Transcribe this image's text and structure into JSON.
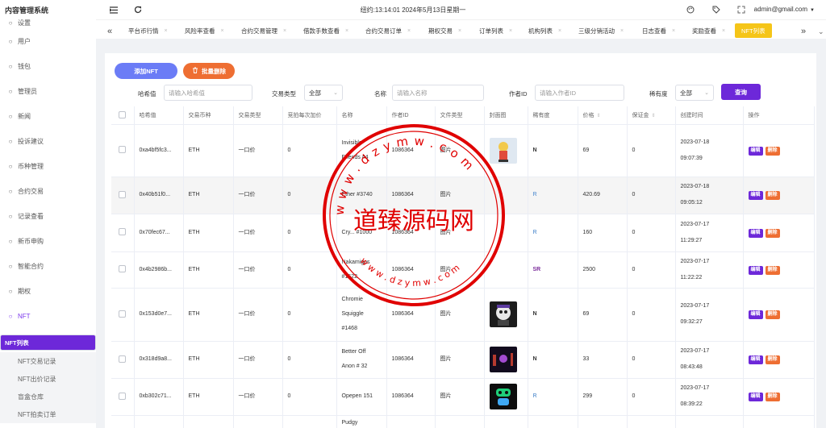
{
  "app": {
    "title": "内容管理系统",
    "datetime": "纽约:13:14:01 2024年5月13日星期一",
    "user": "admin@gmail.com"
  },
  "icons": {
    "menu": "menu-fold-icon",
    "refresh": "refresh-icon",
    "palette": "palette-icon",
    "tag": "tag-icon",
    "fullscreen": "fullscreen-icon"
  },
  "sidebar": {
    "items": [
      {
        "label": "设置",
        "icon": "gear-icon"
      },
      {
        "label": "用户",
        "icon": "user-icon"
      },
      {
        "label": "钱包",
        "icon": "wallet-icon"
      },
      {
        "label": "管理员",
        "icon": "admin-icon"
      },
      {
        "label": "新闻",
        "icon": "news-icon"
      },
      {
        "label": "投诉建议",
        "icon": "feedback-icon"
      },
      {
        "label": "币种管理",
        "icon": "coin-icon"
      },
      {
        "label": "合约交易",
        "icon": "contract-icon"
      },
      {
        "label": "记录查看",
        "icon": "record-icon"
      },
      {
        "label": "新币申购",
        "icon": "newcoin-icon"
      },
      {
        "label": "智能合约",
        "icon": "smart-contract-icon"
      },
      {
        "label": "期权",
        "icon": "option-icon"
      },
      {
        "label": "NFT",
        "icon": "nft-icon"
      }
    ],
    "subitems": [
      "NFT列表",
      "NFT交易记录",
      "NFT出价记录",
      "盲盒仓库",
      "NFT拍卖订单"
    ]
  },
  "tabs": [
    "平台币行情",
    "风险率查看",
    "合约交易管理",
    "借款手数查看",
    "合约交易订单",
    "期权交易",
    "订单列表",
    "机构列表",
    "三级分销活动",
    "日志查看",
    "奖励查看",
    "NFT列表"
  ],
  "toolbar": {
    "add": "添加NFT",
    "batch_delete": "批量删除"
  },
  "filters": {
    "hash_label": "哈希值",
    "hash_placeholder": "请输入哈希值",
    "type_label": "交易类型",
    "type_value": "全部",
    "name_label": "名称",
    "name_placeholder": "请输入名称",
    "author_label": "作者ID",
    "author_placeholder": "请输入作者ID",
    "rarity_label": "稀有度",
    "rarity_value": "全部",
    "search": "查询"
  },
  "table": {
    "columns": [
      "哈希值",
      "交易币种",
      "交易类型",
      "竞拍每次加价",
      "名称",
      "作者ID",
      "文件类型",
      "封面图",
      "稀有度",
      "价格",
      "保证金",
      "创建时间",
      "操作"
    ],
    "actions": {
      "edit": "编辑",
      "delete": "删除"
    },
    "rows": [
      {
        "hash": "0xa4bf5fc3...",
        "coin": "ETH",
        "type": "一口价",
        "inc": "0",
        "name": "Invisible Friends #4",
        "author": "1086364",
        "file": "图片",
        "rarity": "N",
        "price": "69",
        "deposit": "0",
        "date": "2023-07-18",
        "time": "09:07:39",
        "thumb": "img1"
      },
      {
        "hash": "0x40b51f0...",
        "coin": "ETH",
        "type": "一口价",
        "inc": "0",
        "name": "Ether #3740",
        "author": "1086364",
        "file": "图片",
        "rarity": "R",
        "price": "420.69",
        "deposit": "0",
        "date": "2023-07-18",
        "time": "09:05:12",
        "thumb": ""
      },
      {
        "hash": "0x70fec67...",
        "coin": "ETH",
        "type": "一口价",
        "inc": "0",
        "name": "Cry... #1000",
        "author": "1086364",
        "file": "图片",
        "rarity": "R",
        "price": "160",
        "deposit": "0",
        "date": "2023-07-17",
        "time": "11:29:27",
        "thumb": ""
      },
      {
        "hash": "0x4b2986b...",
        "coin": "ETH",
        "type": "一口价",
        "inc": "0",
        "name": "Nakamigos #1622",
        "author": "1086364",
        "file": "图片",
        "rarity": "SR",
        "price": "2500",
        "deposit": "0",
        "date": "2023-07-17",
        "time": "11:22:22",
        "thumb": ""
      },
      {
        "hash": "0x153d0e7...",
        "coin": "ETH",
        "type": "一口价",
        "inc": "0",
        "name": "Chromie Squiggle #1468",
        "author": "1086364",
        "file": "图片",
        "rarity": "N",
        "price": "69",
        "deposit": "0",
        "date": "2023-07-17",
        "time": "09:32:27",
        "thumb": "img2"
      },
      {
        "hash": "0x318d9a8...",
        "coin": "ETH",
        "type": "一口价",
        "inc": "0",
        "name": "Better Off Anon # 32",
        "author": "1086364",
        "file": "图片",
        "rarity": "N",
        "price": "33",
        "deposit": "0",
        "date": "2023-07-17",
        "time": "08:43:48",
        "thumb": "img3"
      },
      {
        "hash": "0xb302c71...",
        "coin": "ETH",
        "type": "一口价",
        "inc": "0",
        "name": "Opepen 151",
        "author": "1086364",
        "file": "图片",
        "rarity": "R",
        "price": "299",
        "deposit": "0",
        "date": "2023-07-17",
        "time": "08:39:22",
        "thumb": "img4"
      },
      {
        "hash": "",
        "coin": "",
        "type": "",
        "inc": "",
        "name": "Pudgy",
        "author": "",
        "file": "",
        "rarity": "",
        "price": "",
        "deposit": "",
        "date": "",
        "time": "",
        "thumb": ""
      }
    ]
  },
  "watermark": {
    "text": "道臻源码网",
    "url": "w w w . d z y m w . c o m"
  },
  "colors": {
    "primary": "#6d28d9",
    "orange": "#ee6e32",
    "blue_btn": "#6b7cf6",
    "active_tab": "#f5c518",
    "watermark": "#e00000",
    "rarity_r": "#7aa7d9",
    "rarity_sr": "#7c2d9c"
  }
}
